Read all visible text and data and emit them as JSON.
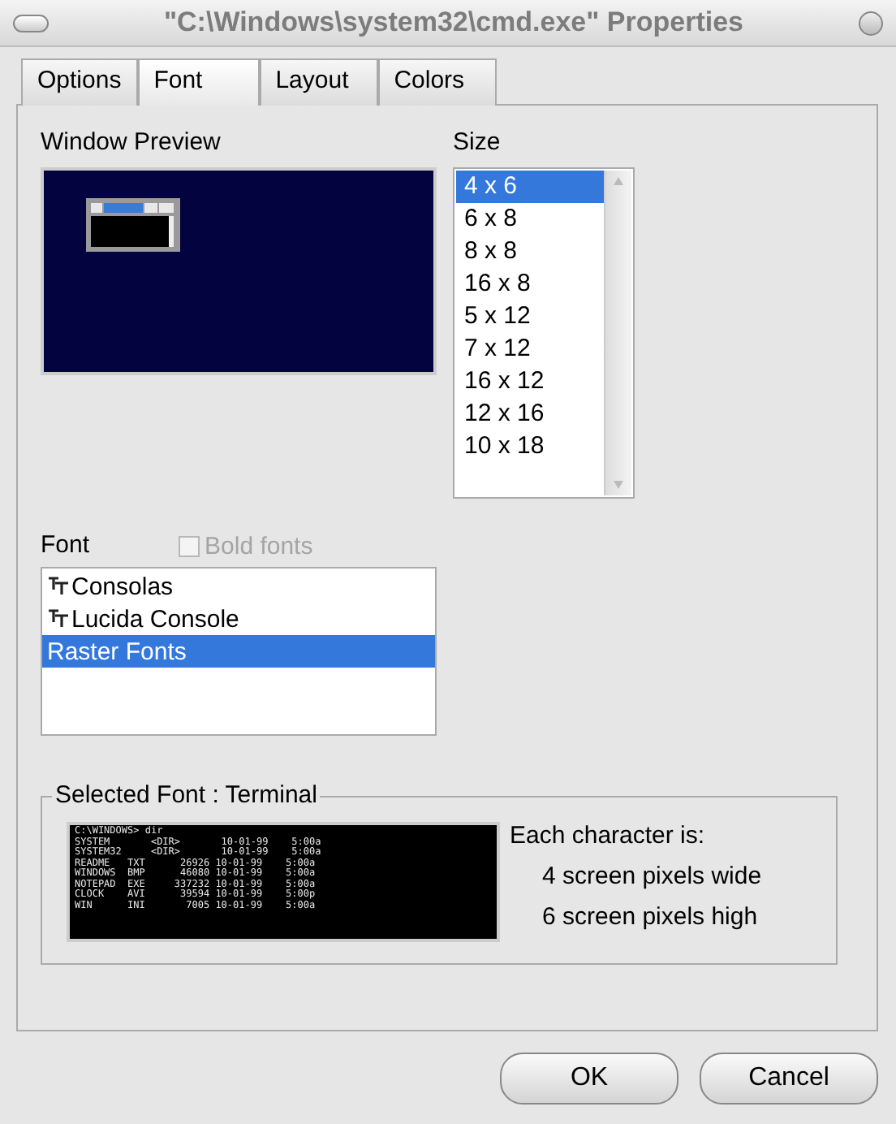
{
  "window": {
    "title": "\"C:\\Windows\\system32\\cmd.exe\" Properties"
  },
  "tabs": [
    {
      "label": "Options",
      "selected": false
    },
    {
      "label": "Font",
      "selected": true
    },
    {
      "label": "Layout",
      "selected": false
    },
    {
      "label": "Colors",
      "selected": false
    }
  ],
  "window_preview": {
    "label": "Window Preview"
  },
  "size": {
    "label": "Size",
    "items": [
      {
        "label": "4 x  6",
        "selected": true
      },
      {
        "label": "6 x  8",
        "selected": false
      },
      {
        "label": "8 x  8",
        "selected": false
      },
      {
        "label": "16 x  8",
        "selected": false
      },
      {
        "label": "5 x 12",
        "selected": false
      },
      {
        "label": "7 x 12",
        "selected": false
      },
      {
        "label": "16 x 12",
        "selected": false
      },
      {
        "label": "12 x 16",
        "selected": false
      },
      {
        "label": "10 x 18",
        "selected": false
      }
    ]
  },
  "font": {
    "label": "Font",
    "bold_fonts": {
      "label": "Bold fonts",
      "checked": false,
      "disabled": true
    },
    "items": [
      {
        "label": "Consolas",
        "kind": "truetype",
        "selected": false
      },
      {
        "label": "Lucida Console",
        "kind": "truetype",
        "selected": false
      },
      {
        "label": "Raster Fonts",
        "kind": "raster",
        "selected": true
      }
    ]
  },
  "selected_font": {
    "legend": "Selected Font : Terminal",
    "preview_lines": [
      "C:\\WINDOWS> dir",
      "SYSTEM       <DIR>       10-01-99    5:00a",
      "SYSTEM32     <DIR>       10-01-99    5:00a",
      "README   TXT      26926 10-01-99    5:00a",
      "WINDOWS  BMP      46080 10-01-99    5:00a",
      "NOTEPAD  EXE     337232 10-01-99    5:00a",
      "CLOCK    AVI      39594 10-01-99    5:00p",
      "WIN      INI       7005 10-01-99    5:00a"
    ],
    "info": [
      "Each character is:",
      "4 screen pixels wide",
      "6 screen pixels high"
    ]
  },
  "buttons": [
    "OK",
    "Cancel"
  ]
}
